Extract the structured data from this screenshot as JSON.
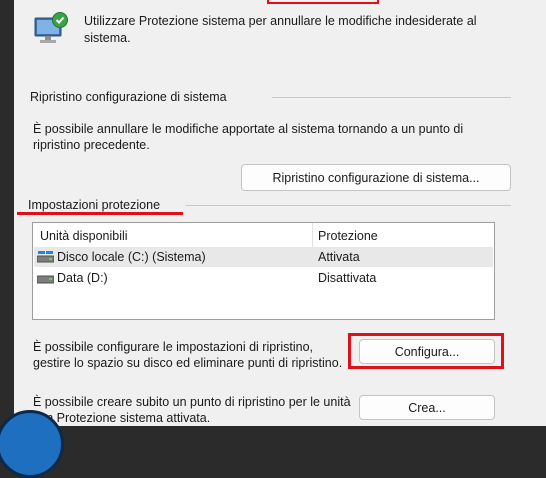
{
  "header": {
    "description": "Utilizzare Protezione sistema per annullare le modifiche indesiderate al sistema."
  },
  "restore_group": {
    "title": "Ripristino configurazione di sistema",
    "text": "È possibile annullare le modifiche apportate al sistema tornando a un punto di ripristino precedente.",
    "button_label": "Ripristino configurazione di sistema..."
  },
  "protection_group": {
    "title": "Impostazioni protezione",
    "columns": [
      "Unità disponibili",
      "Protezione"
    ],
    "drives": [
      {
        "name": "Disco locale (C:) (Sistema)",
        "protection": "Attivata",
        "icon": "system-drive-icon"
      },
      {
        "name": "Data (D:)",
        "protection": "Disattivata",
        "icon": "drive-icon"
      }
    ],
    "configure_text": "È possibile configurare le impostazioni di ripristino, gestire lo spazio su disco ed eliminare punti di ripristino.",
    "configure_label": "Configura...",
    "create_text": "È possibile creare subito un punto di ripristino per le unità con Protezione sistema attivata.",
    "create_label": "Crea..."
  },
  "colors": {
    "highlight": "#e0101a",
    "panel": "#f0f0f0",
    "accent": "#1f6fc0"
  }
}
